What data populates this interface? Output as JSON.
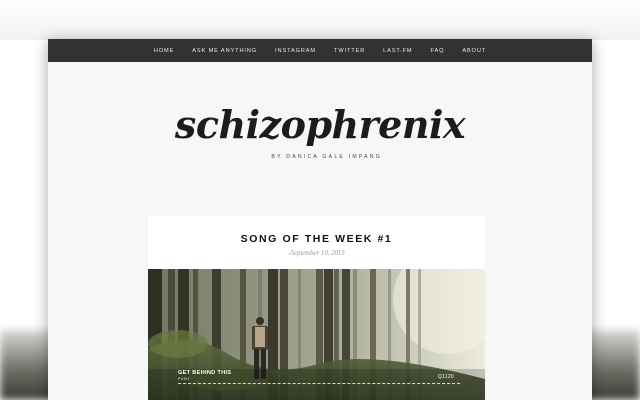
{
  "nav": {
    "items": [
      "HOME",
      "ASK ME ANYTHING",
      "INSTAGRAM",
      "TWITTER",
      "LAST.FM",
      "FAQ",
      "ABOUT"
    ]
  },
  "header": {
    "title": "schizophrenix",
    "byline": "BY DANICA GALE IMPANG"
  },
  "post": {
    "title": "SONG OF THE WEEK #1",
    "date": "-September 10, 2013"
  },
  "player": {
    "song": "GET BEHIND THIS",
    "artist": "PUSH",
    "code": "Q1120"
  },
  "colors": {
    "navbar": "#323232",
    "page_bg": "#f7f7f7",
    "card_bg": "#ffffff"
  }
}
